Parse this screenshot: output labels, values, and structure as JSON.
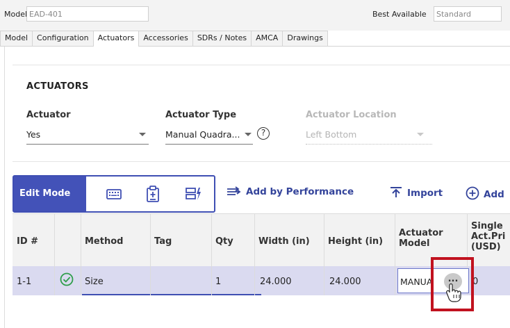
{
  "top": {
    "model_label": "Model",
    "model_value": "EAD-401",
    "best_label": "Best Available",
    "best_value": "Standard"
  },
  "tabs": [
    {
      "label": "Model",
      "active": false
    },
    {
      "label": "Configuration",
      "active": false
    },
    {
      "label": "Actuators",
      "active": true
    },
    {
      "label": "Accessories",
      "active": false
    },
    {
      "label": "SDRs / Notes",
      "active": false
    },
    {
      "label": "AMCA",
      "active": false
    },
    {
      "label": "Drawings",
      "active": false
    }
  ],
  "section": {
    "title": "ACTUATORS",
    "fields": {
      "actuator": {
        "label": "Actuator",
        "value": "Yes"
      },
      "actuator_type": {
        "label": "Actuator Type",
        "value": "Manual Quadra..."
      },
      "actuator_location": {
        "label": "Actuator Location",
        "value": "Left Bottom",
        "disabled": true
      }
    },
    "help_glyph": "?"
  },
  "toolbar": {
    "edit_mode_label": "Edit Mode",
    "icons": [
      "keyboard-icon",
      "paste-icon",
      "bulk-edit-icon"
    ],
    "add_by_performance": "Add by Performance",
    "import": "Import",
    "add": "Add"
  },
  "grid": {
    "headers": {
      "id": "ID #",
      "method": "Method",
      "tag": "Tag",
      "qty": "Qty",
      "width": "Width (in)",
      "height": "Height (in)",
      "actuator_model_1": "Actuator",
      "actuator_model_2": "Model",
      "price_1": "Single",
      "price_2": "Act.Pri",
      "price_3": "(USD)"
    },
    "row": {
      "id": "1-1",
      "status_icon": "check-circle-icon",
      "method": "Size",
      "tag": "",
      "qty": "1",
      "width": "24.000",
      "height": "24.000",
      "actuator_model": "MANUA",
      "ellipsis": "...",
      "price": "0"
    }
  },
  "colors": {
    "accent": "#4352b8",
    "row_selected": "#dadaf0",
    "highlight": "#c1121f",
    "check_green": "#2e9e4b"
  }
}
